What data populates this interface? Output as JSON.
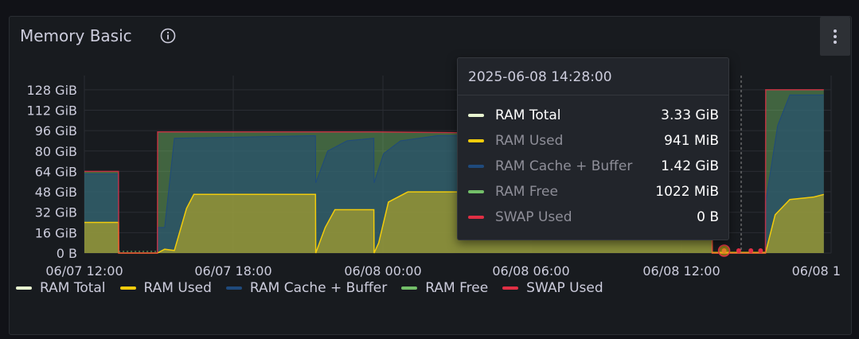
{
  "panel": {
    "title": "Memory Basic",
    "info_icon": "info-circle-icon",
    "menu_icon": "kebab-menu-icon"
  },
  "chart_data": {
    "type": "area",
    "title": "Memory Basic",
    "xlabel": "",
    "ylabel": "",
    "x_ticks": [
      "06/07 12:00",
      "06/07 18:00",
      "06/08 00:00",
      "06/08 06:00",
      "06/08 12:00",
      "06/08 1"
    ],
    "y_ticks": [
      "0 B",
      "16 GiB",
      "32 GiB",
      "48 GiB",
      "64 GiB",
      "80 GiB",
      "96 GiB",
      "112 GiB",
      "128 GiB"
    ],
    "y_unit": "GiB",
    "ylim": [
      0,
      136
    ],
    "x_unit": "hours since 06/07 12:00",
    "xlim": [
      0,
      30.7
    ],
    "grid": true,
    "legend_position": "bottom",
    "series": [
      {
        "name": "RAM Total",
        "color": "#e8f5d0",
        "values": [
          [
            0,
            64
          ],
          [
            1.4,
            64
          ],
          [
            1.41,
            0
          ],
          [
            3.0,
            0
          ],
          [
            3.01,
            95
          ],
          [
            10.0,
            95
          ],
          [
            12.0,
            95
          ],
          [
            17.0,
            94
          ],
          [
            18.0,
            94
          ],
          [
            20.5,
            95
          ],
          [
            24.0,
            95
          ],
          [
            25.8,
            95
          ],
          [
            25.81,
            0
          ],
          [
            28.0,
            0
          ],
          [
            28.01,
            128
          ],
          [
            30.4,
            128
          ]
        ]
      },
      {
        "name": "RAM Used",
        "color": "#f2cc0c",
        "values": [
          [
            0,
            24
          ],
          [
            1.4,
            24
          ],
          [
            1.41,
            0
          ],
          [
            3.0,
            0
          ],
          [
            3.3,
            3
          ],
          [
            3.7,
            2
          ],
          [
            4.2,
            35
          ],
          [
            4.5,
            46
          ],
          [
            9.5,
            46
          ],
          [
            9.51,
            0
          ],
          [
            9.9,
            20
          ],
          [
            10.3,
            34
          ],
          [
            11.9,
            34
          ],
          [
            11.91,
            0
          ],
          [
            12.1,
            8
          ],
          [
            12.5,
            40
          ],
          [
            13.3,
            48
          ],
          [
            18.5,
            48
          ],
          [
            20.0,
            40
          ],
          [
            23.0,
            40
          ],
          [
            25.0,
            40
          ],
          [
            25.8,
            40
          ],
          [
            25.81,
            0
          ],
          [
            28.0,
            0
          ],
          [
            28.4,
            30
          ],
          [
            29.0,
            42
          ],
          [
            30.0,
            44
          ],
          [
            30.4,
            46
          ]
        ]
      },
      {
        "name": "RAM Cache + Buffer",
        "color": "#1f4a7c",
        "values": [
          [
            0,
            62
          ],
          [
            1.4,
            62
          ],
          [
            1.41,
            0
          ],
          [
            3.0,
            0
          ],
          [
            3.01,
            20
          ],
          [
            3.3,
            20
          ],
          [
            3.7,
            90
          ],
          [
            9.5,
            92
          ],
          [
            9.51,
            55
          ],
          [
            10.0,
            80
          ],
          [
            10.8,
            88
          ],
          [
            11.9,
            90
          ],
          [
            11.91,
            55
          ],
          [
            12.3,
            78
          ],
          [
            13.0,
            88
          ],
          [
            14.5,
            92
          ],
          [
            18.0,
            92
          ],
          [
            20.5,
            90
          ],
          [
            24.0,
            90
          ],
          [
            25.8,
            90
          ],
          [
            25.81,
            0
          ],
          [
            28.0,
            0
          ],
          [
            28.01,
            40
          ],
          [
            28.5,
            100
          ],
          [
            29.0,
            124
          ],
          [
            30.4,
            124
          ]
        ]
      },
      {
        "name": "RAM Free",
        "color": "#73bf69",
        "values": [
          [
            0,
            2
          ],
          [
            1.4,
            2
          ],
          [
            3.01,
            75
          ],
          [
            3.3,
            75
          ],
          [
            3.7,
            5
          ],
          [
            9.5,
            3
          ],
          [
            9.51,
            40
          ],
          [
            10.0,
            15
          ],
          [
            10.8,
            7
          ],
          [
            11.9,
            5
          ],
          [
            11.91,
            40
          ],
          [
            12.3,
            17
          ],
          [
            13.0,
            7
          ],
          [
            14.5,
            3
          ],
          [
            18.0,
            2
          ],
          [
            25.8,
            5
          ],
          [
            28.01,
            88
          ],
          [
            28.5,
            28
          ],
          [
            29.0,
            4
          ],
          [
            30.4,
            4
          ]
        ]
      },
      {
        "name": "SWAP Used",
        "color": "#e02f44",
        "values": [
          [
            0,
            0.5
          ],
          [
            30.4,
            0.5
          ]
        ]
      }
    ]
  },
  "legend": [
    {
      "label": "RAM Total",
      "color": "#e8f5d0"
    },
    {
      "label": "RAM Used",
      "color": "#f2cc0c"
    },
    {
      "label": "RAM Cache + Buffer",
      "color": "#1f4a7c"
    },
    {
      "label": "RAM Free",
      "color": "#73bf69"
    },
    {
      "label": "SWAP Used",
      "color": "#e02f44"
    }
  ],
  "tooltip": {
    "time": "2025-06-08 14:28:00",
    "rows": [
      {
        "label": "RAM Total",
        "value": "3.33 GiB",
        "color": "#e8f5d0",
        "active": true
      },
      {
        "label": "RAM Used",
        "value": "941 MiB",
        "color": "#f2cc0c",
        "active": false
      },
      {
        "label": "RAM Cache + Buffer",
        "value": "1.42 GiB",
        "color": "#1f4a7c",
        "active": false
      },
      {
        "label": "RAM Free",
        "value": "1022 MiB",
        "color": "#73bf69",
        "active": false
      },
      {
        "label": "SWAP Used",
        "value": "0 B",
        "color": "#e02f44",
        "active": false
      }
    ]
  }
}
